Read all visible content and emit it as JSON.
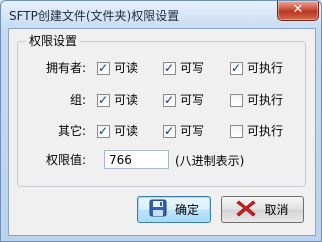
{
  "window": {
    "title": "SFTP创建文件(文件夹)权限设置",
    "close_label": "✕"
  },
  "group": {
    "title": "权限设置",
    "rows": [
      {
        "label": "拥有者:",
        "options": [
          {
            "label": "可读",
            "checked": true
          },
          {
            "label": "可写",
            "checked": true
          },
          {
            "label": "可执行",
            "checked": true
          }
        ]
      },
      {
        "label": "组:",
        "options": [
          {
            "label": "可读",
            "checked": true
          },
          {
            "label": "可写",
            "checked": true
          },
          {
            "label": "可执行",
            "checked": false
          }
        ]
      },
      {
        "label": "其它:",
        "options": [
          {
            "label": "可读",
            "checked": true
          },
          {
            "label": "可写",
            "checked": true
          },
          {
            "label": "可执行",
            "checked": false
          }
        ]
      }
    ],
    "perm_label": "权限值:",
    "perm_value": "766",
    "perm_hint": "(八进制表示)"
  },
  "buttons": {
    "ok_label": "确定",
    "cancel_label": "取消"
  },
  "icons": {
    "ok": "save-disk-icon",
    "cancel": "red-x-icon"
  }
}
